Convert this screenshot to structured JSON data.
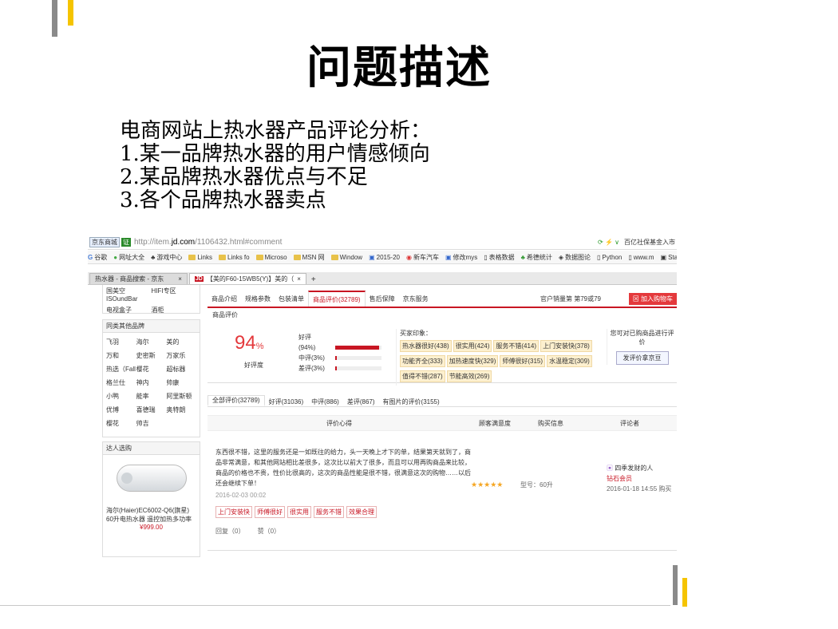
{
  "slide": {
    "title": "问题描述",
    "lines": [
      "电商网站上热水器产品评论分析：",
      "1.某一品牌热水器的用户情感倾向",
      "2.某品牌热水器优点与不足",
      "3.各个品牌热水器卖点"
    ]
  },
  "browser": {
    "site_badge": "京东商城",
    "verified": "证",
    "url_prefix": "http://item.",
    "url_domain": "jd.com",
    "url_rest": "/1106432.html#comment",
    "right_text": "百亿社保基金入市",
    "bookmarks": [
      "谷歌",
      "网址大全",
      "游戏中心",
      "Links",
      "Links fo",
      "Microso",
      "MSN 网",
      "Window",
      "2015-20",
      "新车汽车",
      "修改mys",
      "表格数据",
      "希德统计",
      "数据图论",
      "Python",
      "www.m",
      "StatsMo"
    ],
    "tabs": [
      {
        "label": "热水器 - 商品搜索 - 京东",
        "close": "×"
      },
      {
        "label": "【美的F60-15WB5(Y)】美的（",
        "close": "×"
      }
    ],
    "new_tab": "+",
    "jd_mark": "JD"
  },
  "sidebar": {
    "top_rows": [
      [
        "国美空ISOundBar",
        "HIFI专区"
      ],
      [
        "电视盒子",
        "酒柜"
      ]
    ],
    "brands_title": "同类其他品牌",
    "brands": [
      "飞羽",
      "海尔",
      "美的",
      "万和",
      "史密斯",
      "万家乐",
      "热选（Fall",
      "樱花",
      "超标器",
      "格兰仕",
      "神内",
      "帅康",
      "小鸭",
      "能率",
      "阿里斯顿",
      "优博",
      "喜德瑞",
      "奥特朗",
      "樱花",
      "帅吉",
      ""
    ],
    "expert_title": "达人选购",
    "product_name": "海尔(Haier)EC6002-Q6(旗星) 60升电热水器 遥控加热多功率",
    "product_price": "¥999.00"
  },
  "main": {
    "tabs": [
      "商品介绍",
      "规格参数",
      "包装清单",
      "商品评价(32789)",
      "售后保障",
      "京东服务"
    ],
    "active_tab": 3,
    "sales_rank": "官户销量第 第79或79",
    "add_cart": "加入购物车",
    "section": "商品评价",
    "rating_value": "94",
    "rating_unit": "%",
    "rating_caption": "好评度",
    "ratings": [
      {
        "label": "好评(94%)",
        "pct": 94
      },
      {
        "label": "中评(3%)",
        "pct": 3
      },
      {
        "label": "差评(3%)",
        "pct": 3
      }
    ],
    "impressions_title": "买家印象：",
    "impressions": [
      "热水器很好(438)",
      "很实用(424)",
      "服务不错(414)",
      "上门安装快(378)",
      "功能齐全(333)",
      "加热速度快(329)",
      "师傅很好(315)",
      "水温稳定(309)",
      "值得不错(287)",
      "节能高效(269)"
    ],
    "side_note": "您可对已购商品进行评价",
    "write_btn": "发评价拿京豆",
    "filters": [
      "全部评价(32789)",
      "好评(31036)",
      "中评(886)",
      "差评(867)",
      "有图片的评价(3155)"
    ],
    "columns": [
      "评价心得",
      "顾客满意度",
      "购买信息",
      "评论者"
    ],
    "review": {
      "text": "东西很不错，这里的服务还是一如既往的给力，头一天晚上才下的单，结果第天就到了，商品非常满意，和其他网站相比差很多，这次比以前大了很多，而且可以用再购商品来比较，商品的价格也不贵，性价比很高的，这次的商品性能是很不错，很满意这次的购物……以后还会继续下单！",
      "time": "2016-02-03 00:02",
      "stars": "★★★★★",
      "model": "型号：60升",
      "tags": [
        "上门安装快",
        "师傅很好",
        "很实用",
        "服务不错",
        "效果合理"
      ],
      "reply": "回复（0）",
      "like": "赞（0）",
      "user": "四季发财的人",
      "level": "钻石会员",
      "buy_time": "2016-01-18 14:55 购买"
    }
  }
}
